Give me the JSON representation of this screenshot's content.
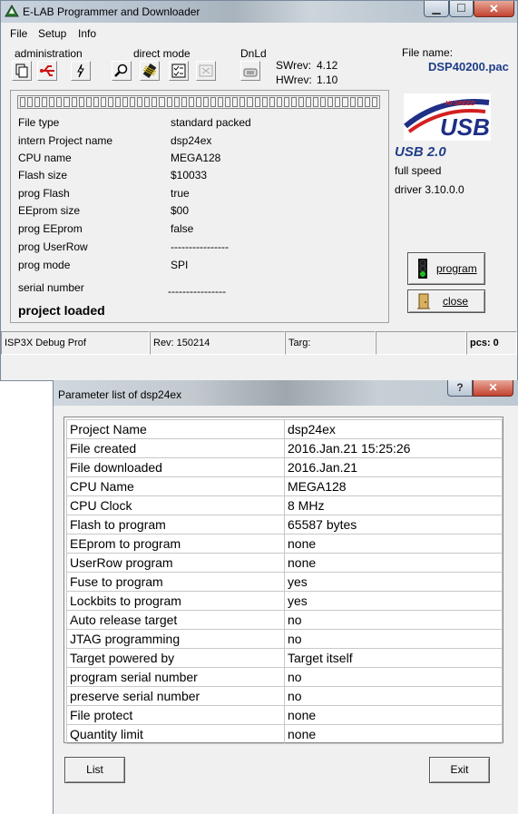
{
  "main_window": {
    "title": "E-LAB  Programmer and Downloader",
    "menu": [
      "File",
      "Setup",
      "Info"
    ],
    "toolbar": {
      "groups": [
        "administration",
        "direct mode",
        "DnLd"
      ],
      "sw_rev_label": "SWrev:",
      "sw_rev_value": "4.12",
      "hw_rev_label": "HWrev:",
      "hw_rev_value": "1.10"
    },
    "file_name_label": "File name:",
    "file_name_value": "DSP40200.pac",
    "info": [
      {
        "label": "File type",
        "value": "standard packed"
      },
      {
        "label": "intern Project name",
        "value": "dsp24ex"
      },
      {
        "label": "CPU name",
        "value": "MEGA128"
      },
      {
        "label": "Flash size",
        "value": "$10033"
      },
      {
        "label": "prog Flash",
        "value": "true"
      },
      {
        "label": "EEprom size",
        "value": "$00"
      },
      {
        "label": "prog EEprom",
        "value": "false"
      },
      {
        "label": "prog UserRow",
        "value": "----------------"
      },
      {
        "label": "prog mode",
        "value": "SPI"
      },
      {
        "label": "serial number",
        "value": "----------------"
      }
    ],
    "status": "project loaded",
    "usb": {
      "logo_top": "HI-SPEED",
      "logo_main": "USB",
      "version": "USB 2.0",
      "speed": "full speed",
      "driver": "driver 3.10.0.0"
    },
    "buttons": {
      "program": "program",
      "close": "close"
    },
    "statusbar": [
      "ISP3X Debug Prof",
      "Rev: 150214",
      "Targ:",
      "",
      "pcs: 0"
    ]
  },
  "dialog": {
    "title": "Parameter list of dsp24ex",
    "help_glyph": "?",
    "close_glyph": "✕",
    "rows": [
      {
        "key": "Project Name",
        "value": "dsp24ex"
      },
      {
        "key": "File created",
        "value": "2016.Jan.21 15:25:26"
      },
      {
        "key": "File downloaded",
        "value": "2016.Jan.21"
      },
      {
        "key": "CPU Name",
        "value": "MEGA128"
      },
      {
        "key": "CPU Clock",
        "value": "8 MHz"
      },
      {
        "key": "Flash to program",
        "value": "65587 bytes"
      },
      {
        "key": "EEprom to program",
        "value": "none"
      },
      {
        "key": "UserRow program",
        "value": "none"
      },
      {
        "key": "Fuse to program",
        "value": "yes"
      },
      {
        "key": "Lockbits to program",
        "value": "yes"
      },
      {
        "key": "Auto release target",
        "value": "no"
      },
      {
        "key": "JTAG programming",
        "value": "no"
      },
      {
        "key": "Target powered by",
        "value": "Target itself"
      },
      {
        "key": "program serial number",
        "value": "no"
      },
      {
        "key": "preserve serial number",
        "value": "no"
      },
      {
        "key": "File protect",
        "value": "none"
      },
      {
        "key": "Quantity limit",
        "value": "none"
      }
    ],
    "buttons": {
      "list": "List",
      "exit": "Exit"
    }
  },
  "icons": [
    "app-icon",
    "copy-icon",
    "usb-icon",
    "bolt-icon",
    "magnifier-icon",
    "chip-icon",
    "checklist-icon",
    "disabled-chip-icon",
    "download-icon",
    "traffic-light-icon",
    "door-icon"
  ]
}
